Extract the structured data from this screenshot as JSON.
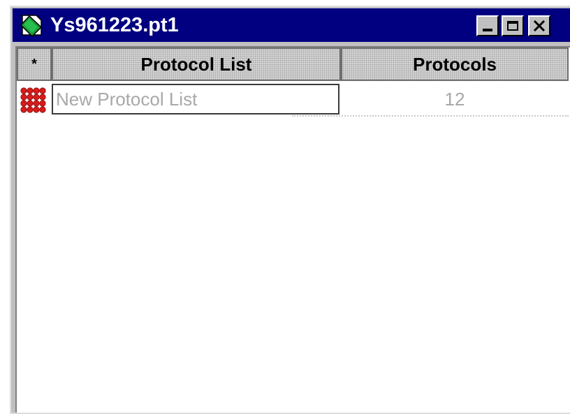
{
  "window": {
    "title": "Ys961223.pt1",
    "icon": "document-icon",
    "controls": {
      "minimize": "minimize-icon",
      "maximize": "maximize-icon",
      "close": "close-icon"
    }
  },
  "table": {
    "headers": {
      "marker": "*",
      "name": "Protocol List",
      "count": "Protocols"
    },
    "rows": [
      {
        "icon": "dot-grid-icon",
        "name": "New Protocol List",
        "count": "12"
      }
    ]
  },
  "colors": {
    "titlebar": "#000080",
    "face": "#c0c0c0",
    "row_icon": "#d81b1b",
    "dim_text": "#a8a8a8"
  }
}
